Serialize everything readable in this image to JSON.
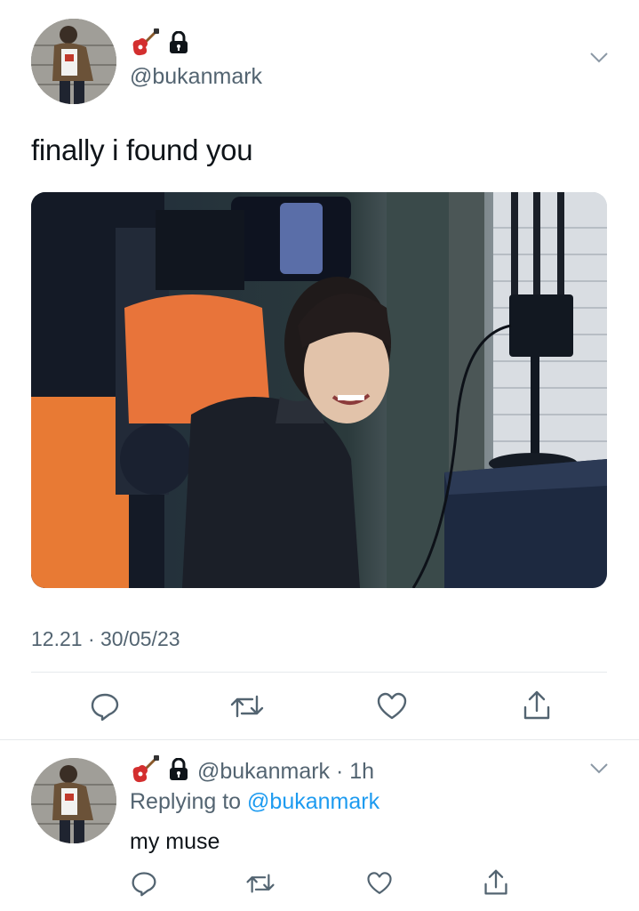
{
  "main_tweet": {
    "handle": "@bukanmark",
    "text": "finally i found you",
    "timestamp": "12.21 · 30/05/23",
    "name_icons": [
      "guitar-icon",
      "lock-icon"
    ]
  },
  "reply": {
    "handle_time": "@bukanmark · 1h",
    "replying_prefix": "Replying to",
    "replying_handle": "@bukanmark",
    "text": "my muse",
    "name_icons": [
      "guitar-icon",
      "lock-icon"
    ]
  },
  "actions": [
    "reply-icon",
    "retweet-icon",
    "like-icon",
    "share-icon"
  ],
  "colors": {
    "text_primary": "#0f1419",
    "text_secondary": "#536471",
    "link": "#1d9bf0",
    "divider": "#e6e9ec"
  }
}
